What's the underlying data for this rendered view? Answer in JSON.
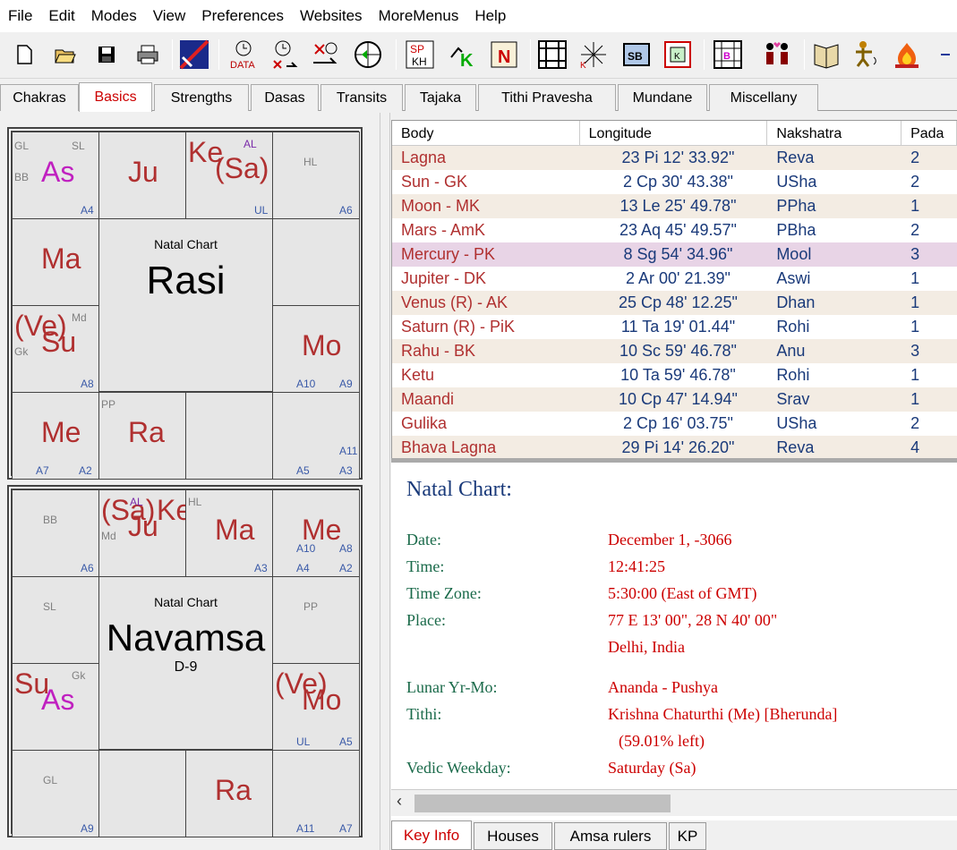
{
  "menu": [
    "File",
    "Edit",
    "Modes",
    "View",
    "Preferences",
    "Websites",
    "MoreMenus",
    "Help"
  ],
  "tabs": [
    "Chakras",
    "Basics",
    "Strengths",
    "Dasas",
    "Transits",
    "Tajaka",
    "Tithi Pravesha",
    "Mundane",
    "Miscellany"
  ],
  "rasi": {
    "title": "Natal Chart",
    "name": "Rasi",
    "sub": ""
  },
  "navamsa": {
    "title": "Natal Chart",
    "name": "Navamsa",
    "sub": "D-9"
  },
  "table": {
    "headers": [
      "Body",
      "Longitude",
      "Nakshatra",
      "Pada"
    ],
    "rows": [
      [
        "Lagna",
        "23 Pi 12' 33.92\"",
        "Reva",
        "2"
      ],
      [
        "Sun - GK",
        "2 Cp 30' 43.38\"",
        "USha",
        "2"
      ],
      [
        "Moon - MK",
        "13 Le 25' 49.78\"",
        "PPha",
        "1"
      ],
      [
        "Mars - AmK",
        "23 Aq 45' 49.57\"",
        "PBha",
        "2"
      ],
      [
        "Mercury - PK",
        "8 Sg 54' 34.96\"",
        "Mool",
        "3"
      ],
      [
        "Jupiter - DK",
        "2 Ar 00' 21.39\"",
        "Aswi",
        "1"
      ],
      [
        "Venus (R) - AK",
        "25 Cp 48' 12.25\"",
        "Dhan",
        "1"
      ],
      [
        "Saturn (R) - PiK",
        "11 Ta 19' 01.44\"",
        "Rohi",
        "1"
      ],
      [
        "Rahu - BK",
        "10 Sc 59' 46.78\"",
        "Anu",
        "3"
      ],
      [
        "Ketu",
        "10 Ta 59' 46.78\"",
        "Rohi",
        "1"
      ],
      [
        "Maandi",
        "10 Cp 47' 14.94\"",
        "Srav",
        "1"
      ],
      [
        "Gulika",
        "2 Cp 16' 03.75\"",
        "USha",
        "2"
      ],
      [
        "Bhava Lagna",
        "29 Pi 14' 26.20\"",
        "Reva",
        "4"
      ]
    ]
  },
  "info": {
    "title": "Natal Chart:",
    "date_l": "Date:",
    "date_v": "December 1, -3066",
    "time_l": "Time:",
    "time_v": "12:41:25",
    "tz_l": "Time Zone:",
    "tz_v": "5:30:00 (East of GMT)",
    "place_l": "Place:",
    "place_v": "77 E 13' 00\", 28 N 40' 00\"",
    "place_v2": "Delhi, India",
    "lunar_l": "Lunar Yr-Mo:",
    "lunar_v": "Ananda - Pushya",
    "tithi_l": "Tithi:",
    "tithi_v": "Krishna Chaturthi (Me) [Bherunda]",
    "tithi_v2": "(59.01% left)",
    "wd_l": "Vedic Weekday:",
    "wd_v": "Saturday (Sa)"
  },
  "bottom_tabs": [
    "Key Info",
    "Houses",
    "Amsa rulers",
    "KP"
  ]
}
